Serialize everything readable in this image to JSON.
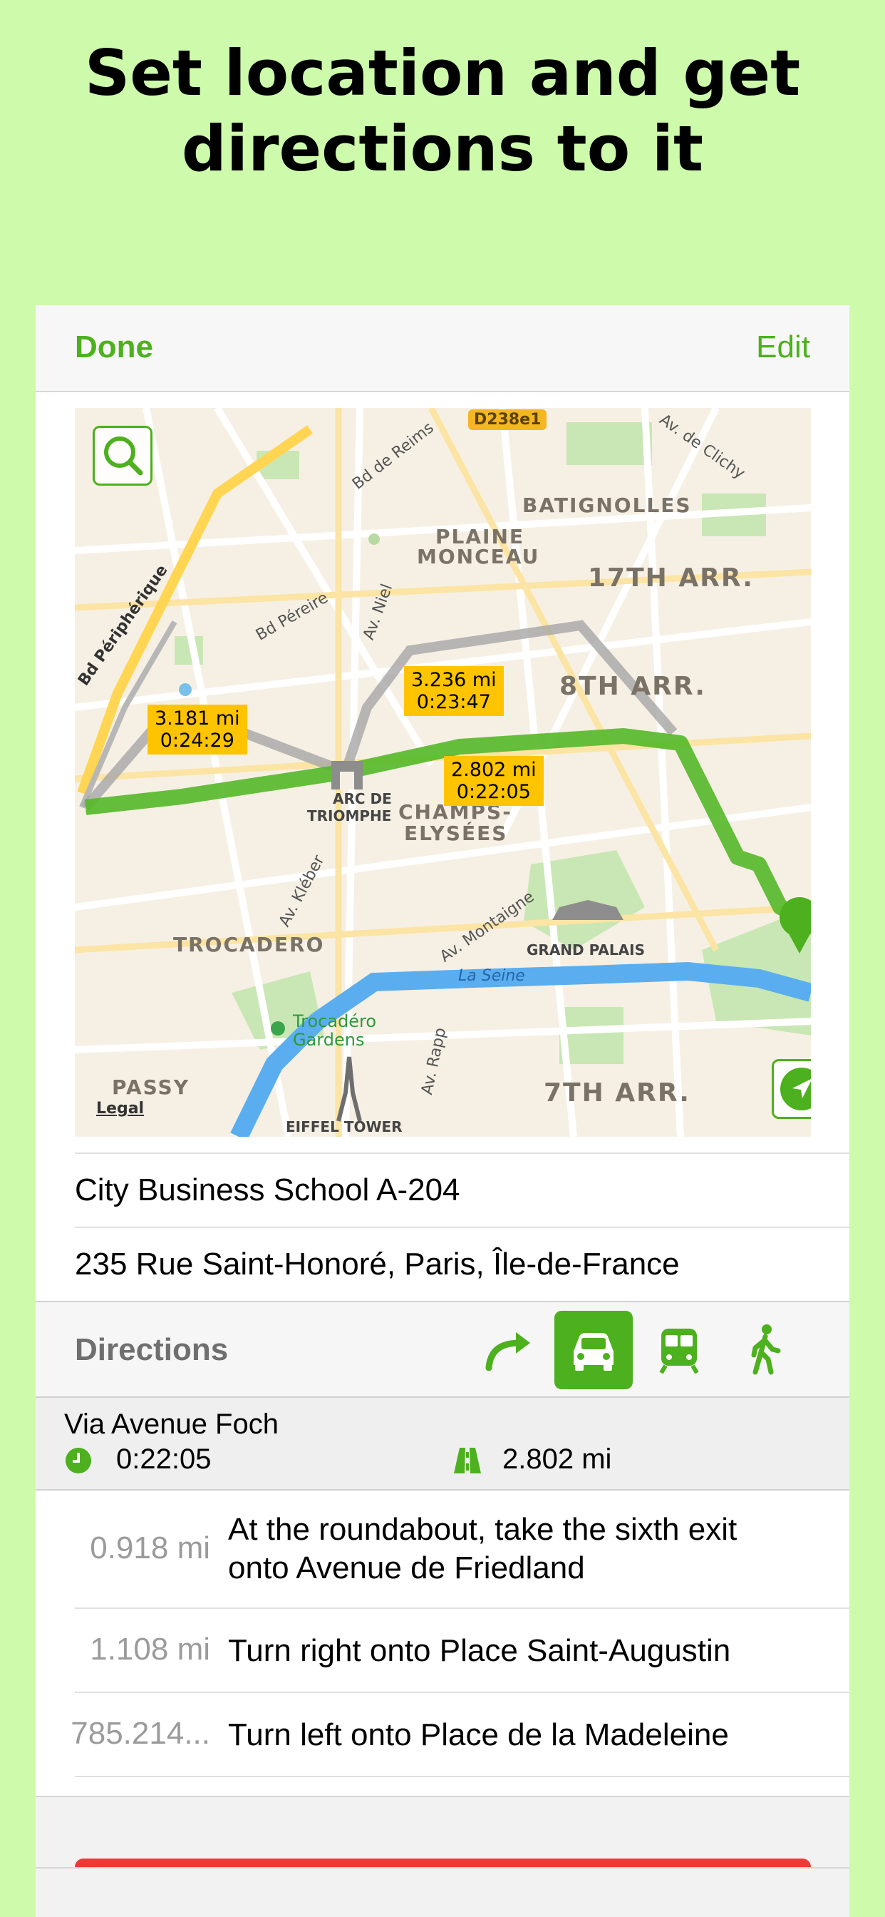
{
  "headline": "Set location and get directions to it",
  "navbar": {
    "done_label": "Done",
    "edit_label": "Edit"
  },
  "map": {
    "callouts": [
      {
        "distance": "3.181 mi",
        "time": "0:24:29"
      },
      {
        "distance": "3.236 mi",
        "time": "0:23:47"
      },
      {
        "distance": "2.802 mi",
        "time": "0:22:05"
      }
    ],
    "labels": {
      "batignolles": "BATIGNOLLES",
      "plaine_monceau_1": "PLAINE",
      "plaine_monceau_2": "MONCEAU",
      "arr17": "17TH ARR.",
      "arr8": "8TH ARR.",
      "champs_1": "CHAMPS-",
      "champs_2": "ELYSÉES",
      "trocadero": "TROCADERO",
      "grand_palais": "GRAND PALAIS",
      "arr7": "7TH ARR.",
      "passy": "PASSY",
      "eiffel": "EIFFEL TOWER",
      "arc_1": "ARC DE",
      "arc_2": "TRIOMPHE",
      "la_seine": "La Seine",
      "trocadero_gardens_1": "Trocadéro",
      "trocadero_gardens_2": "Gardens",
      "bd_peripherique": "Bd Périphérique",
      "bd_pereire": "Bd Péreire",
      "bd_de_reims": "Bd de Reims",
      "av_niel": "Av. Niel",
      "av_kleber": "Av. Kléber",
      "av_montaigne": "Av. Montaigne",
      "av_rapp": "Av. Rapp",
      "av_de_clichy": "Av. de Clichy",
      "d238": "D238e1",
      "legal": "Legal"
    }
  },
  "location": {
    "name": "City Business School A-204",
    "address": "235 Rue Saint-Honoré, Paris, Île-de-France"
  },
  "directions": {
    "title": "Directions",
    "modes": [
      "directions-arrow-icon",
      "car-icon",
      "train-icon",
      "walk-icon"
    ],
    "active_mode": "car",
    "route": {
      "via": "Via Avenue Foch",
      "time": "0:22:05",
      "distance": "2.802 mi"
    },
    "steps": [
      {
        "distance": "0.918 mi",
        "instruction_1": "At the roundabout, take the sixth exit",
        "instruction_2": "onto Avenue de Friedland"
      },
      {
        "distance": "1.108 mi",
        "instruction_1": "Turn right onto Place Saint-Augustin"
      },
      {
        "distance": "785.214...",
        "instruction_1": "Turn left onto Place de la Madeleine"
      }
    ]
  },
  "colors": {
    "accent": "#4db01e",
    "background": "#cdfbab",
    "callout": "#ffc400",
    "delete": "#ee3a37"
  }
}
